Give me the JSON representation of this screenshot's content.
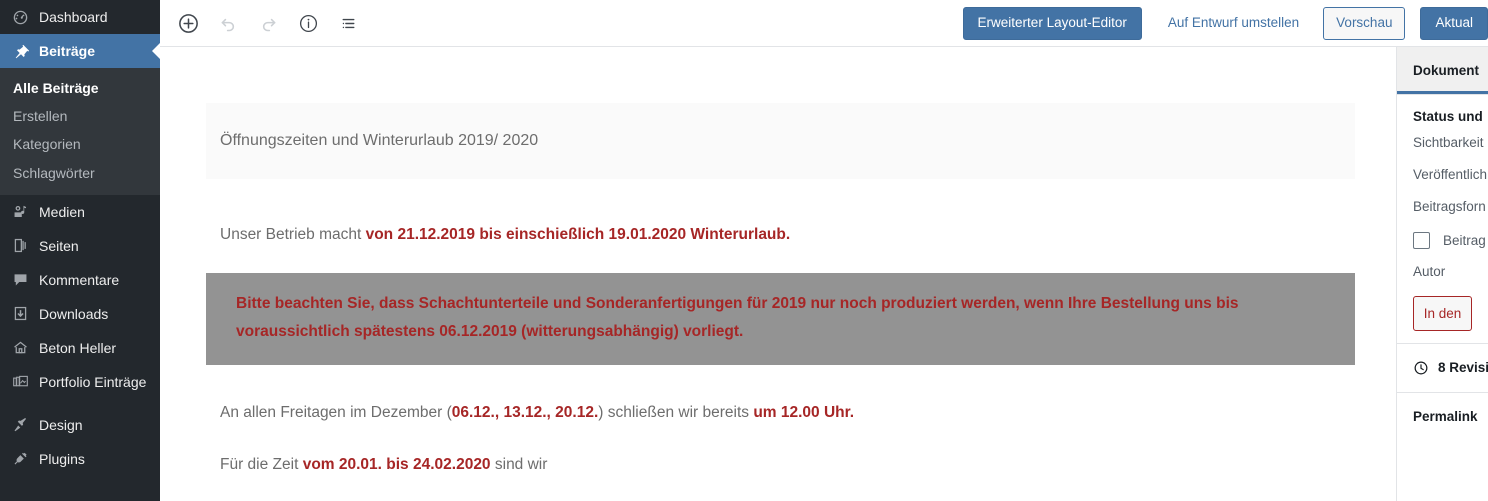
{
  "admin_menu": {
    "items": [
      {
        "label": "Dashboard",
        "icon": "dashboard-icon",
        "current": false
      },
      {
        "label": "Beiträge",
        "icon": "pin-icon",
        "current": true
      },
      {
        "label": "Medien",
        "icon": "media-icon",
        "current": false
      },
      {
        "label": "Seiten",
        "icon": "pages-icon",
        "current": false
      },
      {
        "label": "Kommentare",
        "icon": "comments-icon",
        "current": false
      },
      {
        "label": "Downloads",
        "icon": "download-icon",
        "current": false
      },
      {
        "label": "Beton Heller",
        "icon": "home-icon",
        "current": false
      },
      {
        "label": "Portfolio Einträge",
        "icon": "portfolio-icon",
        "current": false
      },
      {
        "label": "Design",
        "icon": "appearance-brush-icon",
        "current": false
      },
      {
        "label": "Plugins",
        "icon": "plugin-icon",
        "current": false
      }
    ],
    "submenu": [
      {
        "label": "Alle Beiträge",
        "current": true
      },
      {
        "label": "Erstellen",
        "current": false
      },
      {
        "label": "Kategorien",
        "current": false
      },
      {
        "label": "Schlagwörter",
        "current": false
      }
    ]
  },
  "toolbar": {
    "add_block_title": "Block hinzufügen",
    "undo_title": "Rückgängig",
    "redo_title": "Wiederholen",
    "info_title": "Informationen zum Inhalt",
    "list_view_title": "Blockübersicht",
    "layout_editor_label": "Erweiterter Layout-Editor",
    "switch_draft_label": "Auf Entwurf umstellen",
    "preview_label": "Vorschau",
    "update_label": "Aktual"
  },
  "editor": {
    "post_title": "Öffnungszeiten und Winterurlaub 2019/ 2020",
    "paragraph_1": {
      "plain_start": "Unser Betrieb macht ",
      "bold_red": "von 21.12.2019 bis einschießlich 19.01.2020 Winterurlaub."
    },
    "highlight_block": {
      "text": "Bitte beachten Sie, dass Schachtunterteile und Sonderanfertigungen für 2019 nur noch produziert werden, wenn Ihre Bestellung uns bis voraussichtlich spätestens 06.12.2019 (witterungsabhängig) vorliegt.",
      "background_color": "#939393",
      "text_color": "#a62626"
    },
    "paragraph_3": {
      "seg_1": "An allen Freitagen im Dezember (",
      "seg_2_red": "06.12., 13.12., 20.12.",
      "seg_3": ") schließen wir bereits ",
      "seg_4_red": "um 12.00 Uhr."
    },
    "paragraph_4": {
      "seg_1": "Für die Zeit ",
      "seg_2_red": "vom 20.01. bis 24.02.2020",
      "seg_3": " sind wir"
    }
  },
  "settings_sidebar": {
    "tabs": [
      {
        "label": "Dokument",
        "active": true
      }
    ],
    "status_heading": "Status und ",
    "visibility_label": "Sichtbarkeit",
    "publish_label": "Veröffentlich",
    "post_format_label": "Beitragsforn",
    "sticky_checkbox_label": "Beitrag",
    "author_label": "Autor",
    "trash_label": "In den",
    "revisions_label": "8 Revisi",
    "permalink_label": "Permalink"
  },
  "colors": {
    "admin_bg": "#23282d",
    "submenu_bg": "#32373c",
    "accent_blue": "#4373a5",
    "red_text": "#a62626",
    "body_text": "#6d6d6d",
    "highlight_gray": "#939393"
  }
}
